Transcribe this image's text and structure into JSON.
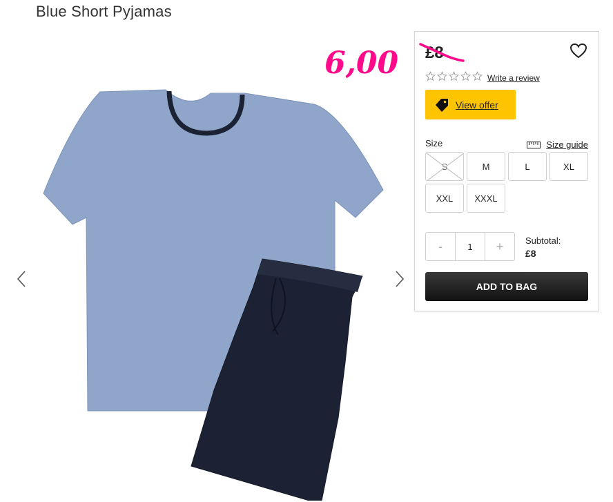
{
  "product": {
    "title": "Blue Short Pyjamas",
    "promo_price": "6,00",
    "old_price": "£8"
  },
  "rating": {
    "stars": 0,
    "max_stars": 5,
    "review_link": "Write a review"
  },
  "offer": {
    "label": "View offer"
  },
  "size": {
    "label": "Size",
    "guide_label": "Size guide",
    "options": [
      {
        "label": "S",
        "available": false
      },
      {
        "label": "M",
        "available": true
      },
      {
        "label": "L",
        "available": true
      },
      {
        "label": "XL",
        "available": true
      },
      {
        "label": "XXL",
        "available": true
      },
      {
        "label": "XXXL",
        "available": true
      }
    ]
  },
  "quantity": {
    "minus": "-",
    "value": "1",
    "plus": "+"
  },
  "subtotal": {
    "label": "Subtotal:",
    "amount": "£8"
  },
  "cart": {
    "add_label": "ADD TO BAG"
  },
  "colors": {
    "promo": "#ff0a8a",
    "offer_button": "#ffc400",
    "add_button": "#1a1a1a",
    "tshirt": "#8fa5c9",
    "shorts": "#1c2233"
  },
  "icons": {
    "prev": "chevron-left-icon",
    "next": "chevron-right-icon",
    "wishlist": "heart-icon",
    "offer": "tag-icon",
    "size_guide": "ruler-icon",
    "rating": "star-icon"
  }
}
